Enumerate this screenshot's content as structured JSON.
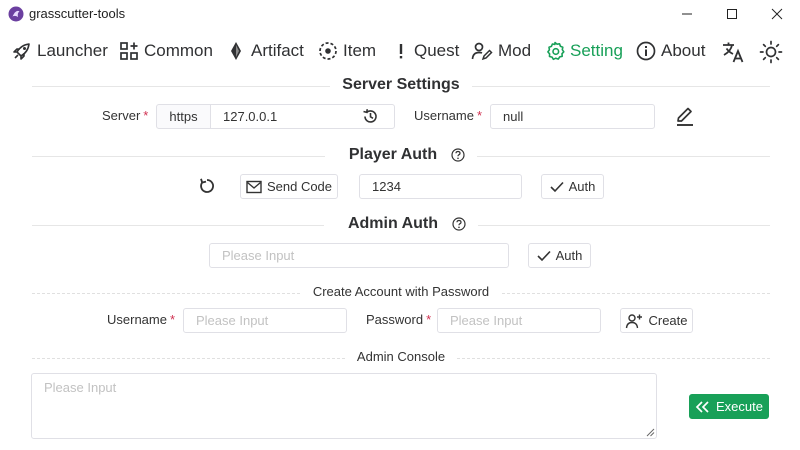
{
  "window": {
    "title": "grasscutter-tools"
  },
  "nav": {
    "items": [
      {
        "label": "Launcher"
      },
      {
        "label": "Common"
      },
      {
        "label": "Artifact"
      },
      {
        "label": "Item"
      },
      {
        "label": "Quest"
      },
      {
        "label": "Mod"
      },
      {
        "label": "Setting"
      },
      {
        "label": "About"
      }
    ],
    "active": "Setting",
    "accent_color": "#18a058"
  },
  "server_settings": {
    "title": "Server Settings",
    "server_label": "Server",
    "protocol": "https",
    "server_value": "127.0.0.1",
    "username_label": "Username",
    "username_value": "null"
  },
  "player_auth": {
    "title": "Player Auth",
    "send_code_label": "Send Code",
    "code_value": "1234",
    "auth_label": "Auth"
  },
  "admin_auth": {
    "title": "Admin Auth",
    "placeholder": "Please Input",
    "auth_label": "Auth"
  },
  "create_account": {
    "title": "Create Account with Password",
    "username_label": "Username",
    "username_placeholder": "Please Input",
    "password_label": "Password",
    "password_placeholder": "Please Input",
    "create_label": "Create"
  },
  "admin_console": {
    "title": "Admin Console",
    "placeholder": "Please Input",
    "execute_label": "Execute"
  },
  "required_mark": "*"
}
